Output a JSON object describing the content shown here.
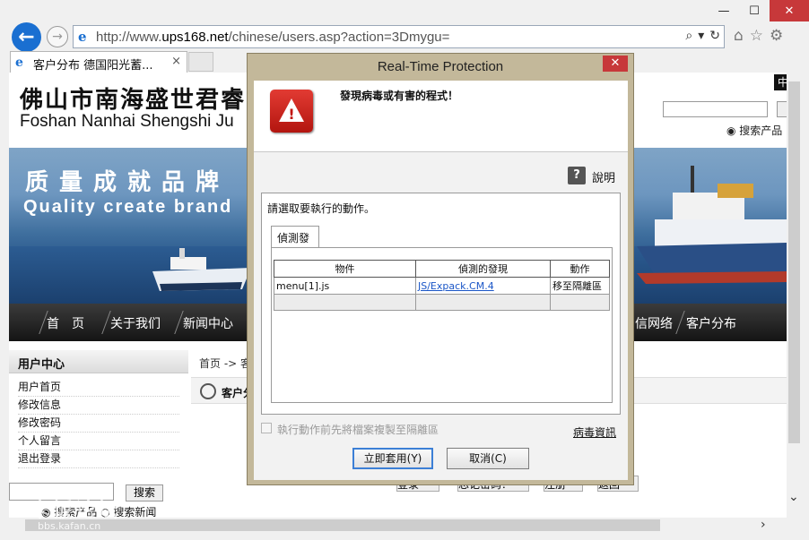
{
  "browser": {
    "url_prefix": "http://www.",
    "url_domain": "ups168.net",
    "url_path": "/chinese/users.asp?action=3Dmygu=",
    "tab_title": "客户分布 德国阳光蓄...",
    "tab_close": "×",
    "search_glyph": "⌕",
    "dropdown_glyph": "▾",
    "reload_glyph": "↻",
    "window": {
      "minimize": "—",
      "maximize": "☐",
      "close": "✕"
    },
    "tools": {
      "home": "⌂",
      "favorites": "☆",
      "settings": "⚙"
    },
    "back": "←",
    "forward": "→"
  },
  "site": {
    "title_cn": "佛山市南海盛世君睿",
    "title_en": "Foshan Nanhai Shengshi Ju",
    "lang": "中",
    "search_option": "搜索产品",
    "slogan_cn": "质量成就品牌",
    "slogan_en": "Quality create brand",
    "nav": [
      "首　页",
      "关于我们",
      "新闻中心",
      "信网络",
      "客户分布"
    ],
    "sidebar": {
      "title": "用户中心",
      "links": [
        "用户首页",
        "修改信息",
        "修改密码",
        "个人留言",
        "退出登录"
      ],
      "search_button": "搜索",
      "radio_product": "搜索产品",
      "radio_news": "搜索新闻"
    },
    "breadcrumb": "首页 -> 客",
    "section_title": "客户分",
    "bottom_buttons": [
      "登录",
      "忘记密码？",
      "注册",
      "返回"
    ]
  },
  "dialog": {
    "title": "Real-Time Protection",
    "close": "✕",
    "warning_icon": "!",
    "message": "發現病毒或有害的程式！",
    "help_icon": "?",
    "help_label": "說明",
    "action_prompt": "請選取要執行的動作。",
    "tab_label": "偵測發現",
    "table": {
      "headers": [
        "物件",
        "偵測的發現",
        "動作"
      ],
      "rows": [
        {
          "object": "menu[1].js",
          "finding": "JS/Expack.CM.4",
          "action": "移至隔離區"
        }
      ]
    },
    "checkbox_label": "執行動作前先將檔案複製至隔離區",
    "virus_info": "病毒資訊",
    "apply_button": "立即套用(Y)",
    "cancel_button": "取消(C)"
  },
  "watermark": {
    "text": "卡饭论坛",
    "url": "bbs.kafan.cn"
  }
}
